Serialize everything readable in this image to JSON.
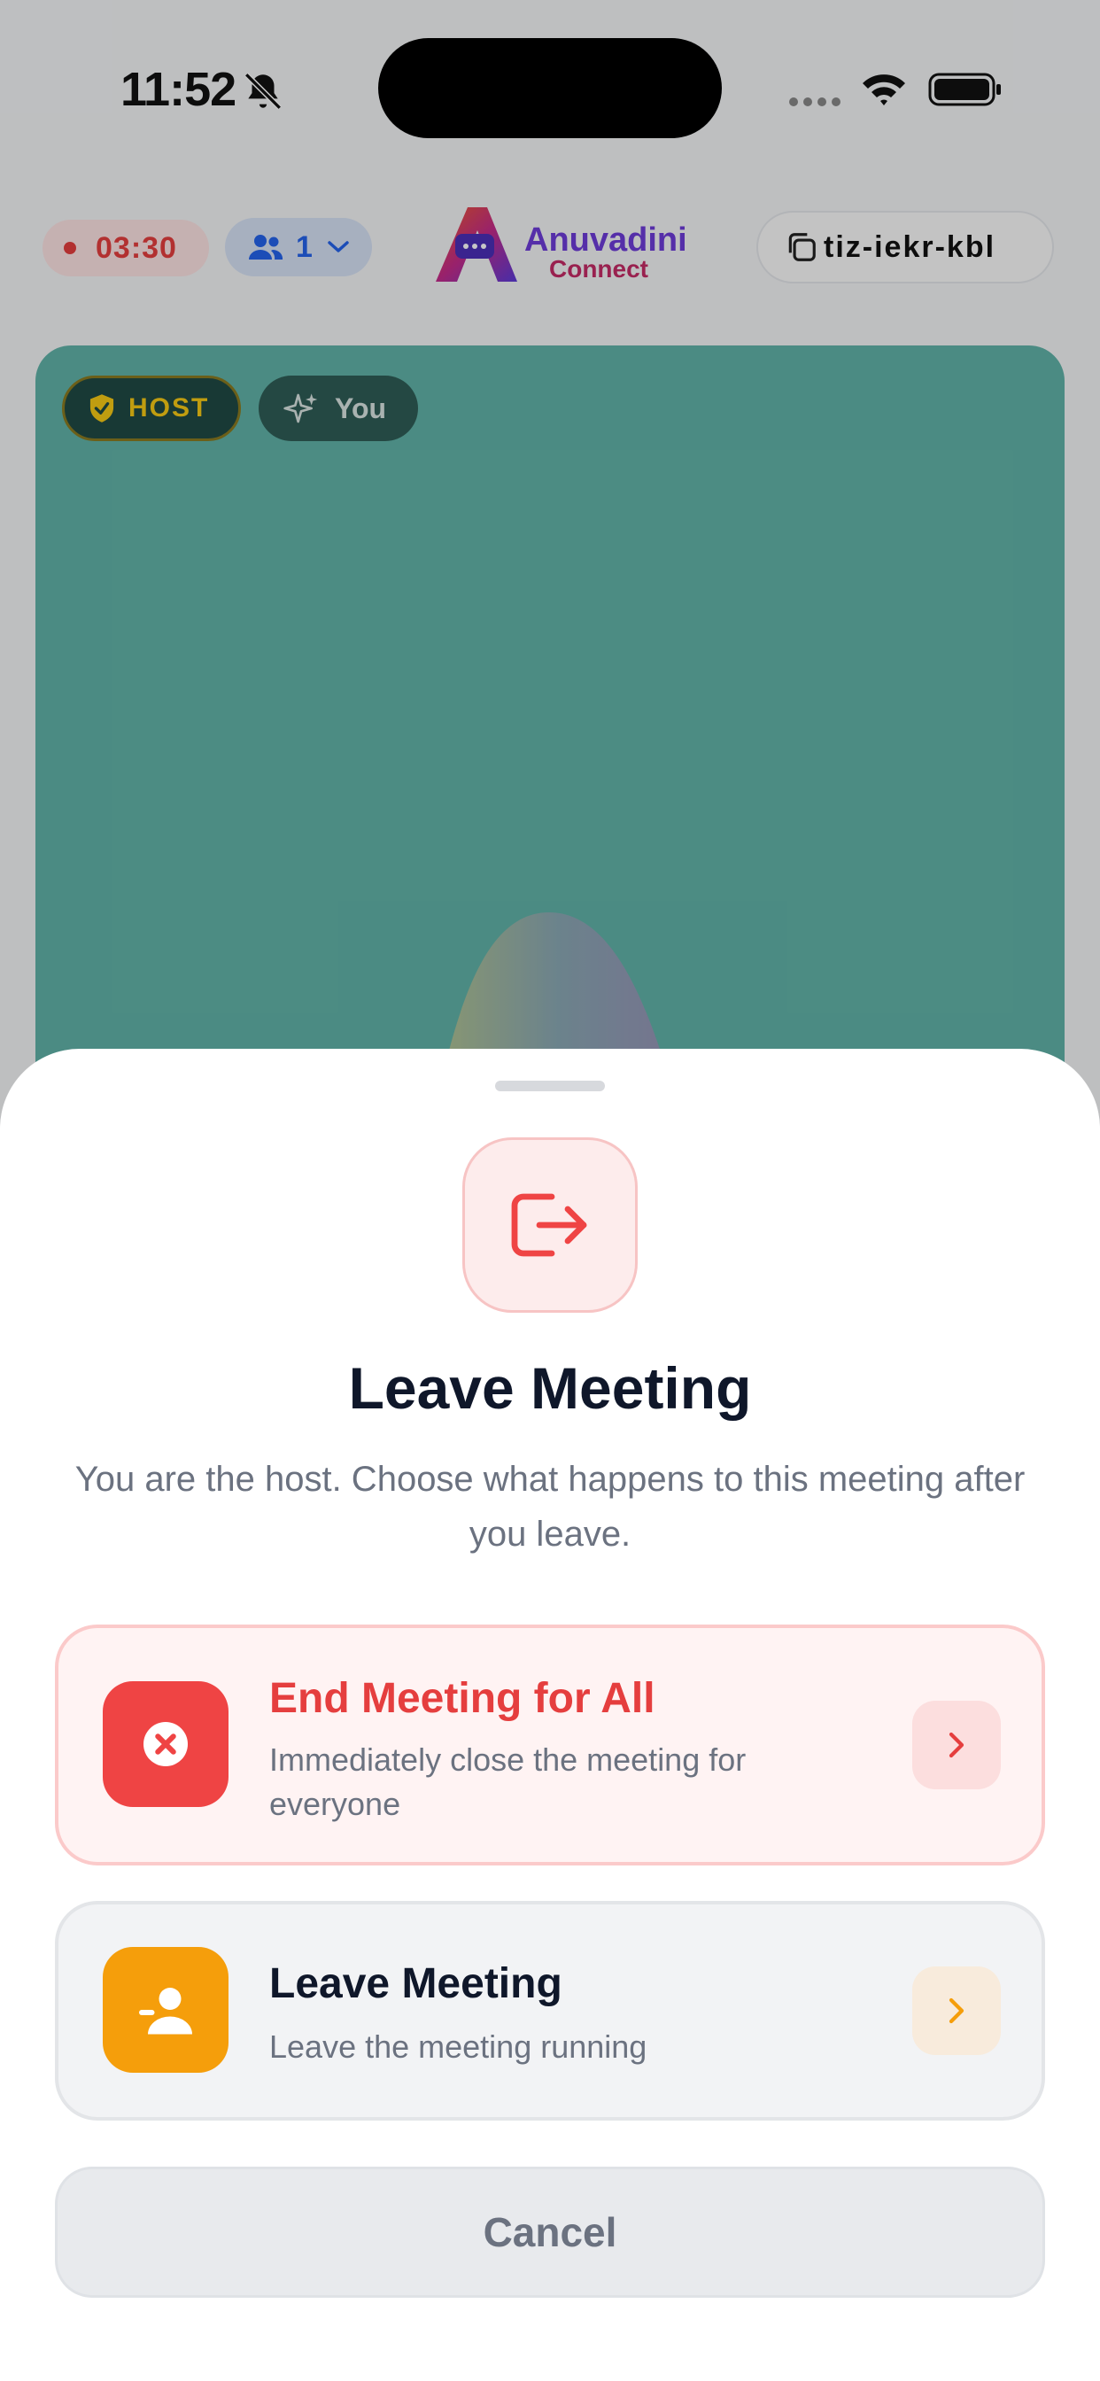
{
  "status_bar": {
    "time": "11:52",
    "icons": [
      "bell-slash-icon",
      "signal-icon",
      "wifi-icon",
      "battery-icon"
    ]
  },
  "top_bar": {
    "recording_time": "03:30",
    "participant_count": "1",
    "logo": {
      "line1": "Anuvadini",
      "line2": "Connect"
    },
    "meeting_code": "tiz-iekr-kbl"
  },
  "video_tile": {
    "host_badge": "HOST",
    "you_badge": "You"
  },
  "sheet": {
    "title": "Leave Meeting",
    "subtitle": "You are the host. Choose what happens to this meeting after you leave.",
    "options": [
      {
        "title": "End Meeting for All",
        "description": "Immediately close the meeting for everyone",
        "icon": "close-circle-icon",
        "color": "#ef4444"
      },
      {
        "title": "Leave Meeting",
        "description": "Leave the meeting running",
        "icon": "user-minus-icon",
        "color": "#f59e0b"
      }
    ],
    "cancel_label": "Cancel"
  },
  "colors": {
    "danger": "#ef4444",
    "warning": "#f59e0b",
    "accent_blue": "#2563eb",
    "video_bg": "#61b3a8"
  }
}
